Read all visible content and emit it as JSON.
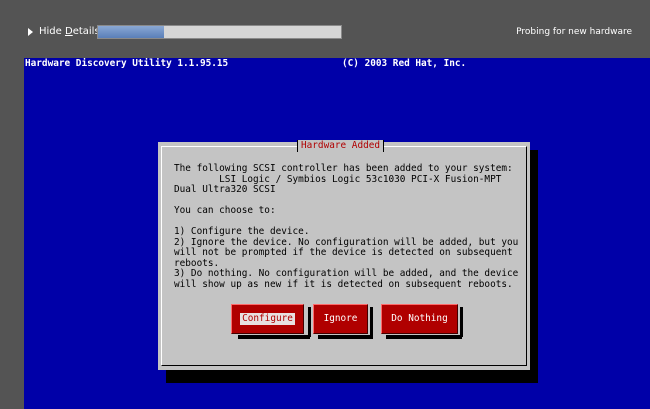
{
  "topbar": {
    "hide_details_prefix": "Hide ",
    "hide_details_underlined": "D",
    "hide_details_suffix": "etails",
    "progress_fraction": 0.27,
    "status": "Probing for new hardware"
  },
  "terminal": {
    "header_left": "Hardware Discovery Utility 1.1.95.15",
    "header_right": "(C) 2003 Red Hat, Inc.",
    "background": "#0000a8"
  },
  "dialog": {
    "title": "Hardware Added",
    "body": "The following SCSI controller has been added to your system:\n        LSI Logic / Symbios Logic 53c1030 PCI-X Fusion-MPT\nDual Ultra320 SCSI\n\nYou can choose to:\n\n1) Configure the device.\n2) Ignore the device. No configuration will be added, but you\nwill not be prompted if the device is detected on subsequent\nreboots.\n3) Do nothing. No configuration will be added, and the device\nwill show up as new if it is detected on subsequent reboots.",
    "buttons": {
      "configure": "Configure",
      "ignore": "Ignore",
      "do_nothing": "Do Nothing"
    },
    "accent_color": "#b00000"
  }
}
